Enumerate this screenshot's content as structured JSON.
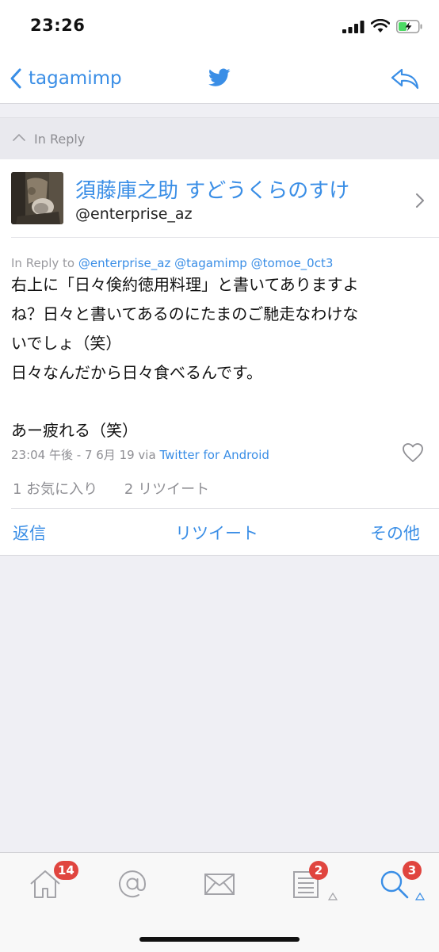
{
  "status_bar": {
    "time": "23:26"
  },
  "nav": {
    "back_label": "tagamimp"
  },
  "in_reply": {
    "label": "In Reply"
  },
  "tweet": {
    "display_name": "須藤庫之助 すどうくらのすけ",
    "screen_name": "@enterprise_az",
    "reply_to_prefix": "In Reply to",
    "reply_to_mentions": [
      "@enterprise_az",
      "@tagamimp",
      "@tomoe_0ct3"
    ],
    "body_lines": [
      "右上に「日々倹約徳用料理」と書いてありますよ",
      "ね？日々と書いてあるのにたまのご馳走なわけな",
      "いでしょ（笑）",
      "日々なんだから日々食べるんです。",
      "",
      "あー疲れる（笑）"
    ],
    "timestamp": "23:04 午後 - 7 6月 19 via",
    "source": "Twitter for Android",
    "favorites": "1 お気に入り",
    "retweets": "2 リツイート",
    "actions": {
      "reply": "返信",
      "retweet": "リツイート",
      "more": "その他"
    }
  },
  "tab_bar": {
    "home_badge": "14",
    "lists_badge": "2",
    "search_badge": "3"
  },
  "colors": {
    "accent": "#3a8ee6",
    "badge": "#e0453f",
    "background": "#efeff4"
  }
}
